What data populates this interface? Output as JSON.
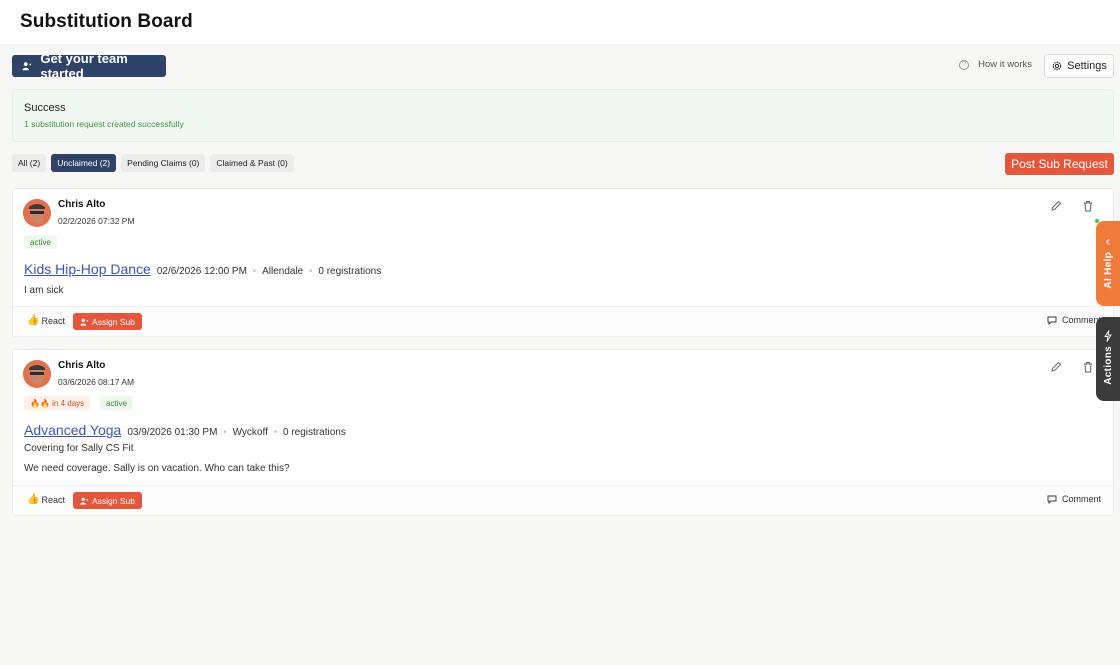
{
  "page": {
    "title": "Substitution Board"
  },
  "toolbar": {
    "team_button": "Get your team started",
    "how_link": "How it works",
    "settings": "Settings"
  },
  "alert": {
    "title": "Success",
    "message": "1 substitution request created successfully"
  },
  "tabs": [
    {
      "label": "All (2)",
      "active": false
    },
    {
      "label": "Unclaimed (2)",
      "active": true
    },
    {
      "label": "Pending Claims (0)",
      "active": false
    },
    {
      "label": "Claimed & Past (0)",
      "active": false
    }
  ],
  "post_button": "Post Sub Request",
  "posts": [
    {
      "author": "Chris Alto",
      "timestamp": "02/2/2026 07:32 PM",
      "badges": [
        "active"
      ],
      "class_title": "Kids Hip-Hop Dance",
      "class_time": "02/6/2026 12:00 PM",
      "location": "Allendale",
      "registrations": "0 registrations",
      "note": "",
      "message": "I am sick",
      "react": "React",
      "assign": "Assign Sub",
      "comment": "Comment"
    },
    {
      "author": "Chris Alto",
      "timestamp": "03/6/2026 08:17 AM",
      "badges": [
        "🔥🔥 in 4 days",
        "active"
      ],
      "class_title": "Advanced Yoga",
      "class_time": "03/9/2026 01:30 PM",
      "location": "Wyckoff",
      "registrations": "0 registrations",
      "note": "Covering for Sally CS Fit",
      "message": "We need coverage. Sally is on vacation. Who can take this?",
      "react": "React",
      "assign": "Assign Sub",
      "comment": "Comment"
    }
  ],
  "side_tabs": {
    "ai_help": "AI Help",
    "actions": "Actions"
  },
  "icons": {
    "team": "person-add-icon",
    "help": "question-circle-icon",
    "settings": "gear-icon",
    "edit": "pencil-icon",
    "delete": "trash-icon",
    "react": "thumbs-up-icon",
    "comment": "speech-bubble-icon",
    "expand": "chevron-left-icon",
    "actions": "lightning-icon"
  },
  "colors": {
    "primary": "#2f4368",
    "accent": "#e3583d",
    "ai_tab": "#f07a3a",
    "actions_tab": "#3b3b3b",
    "success": "#3e9a3e",
    "link": "#3a56b3"
  }
}
